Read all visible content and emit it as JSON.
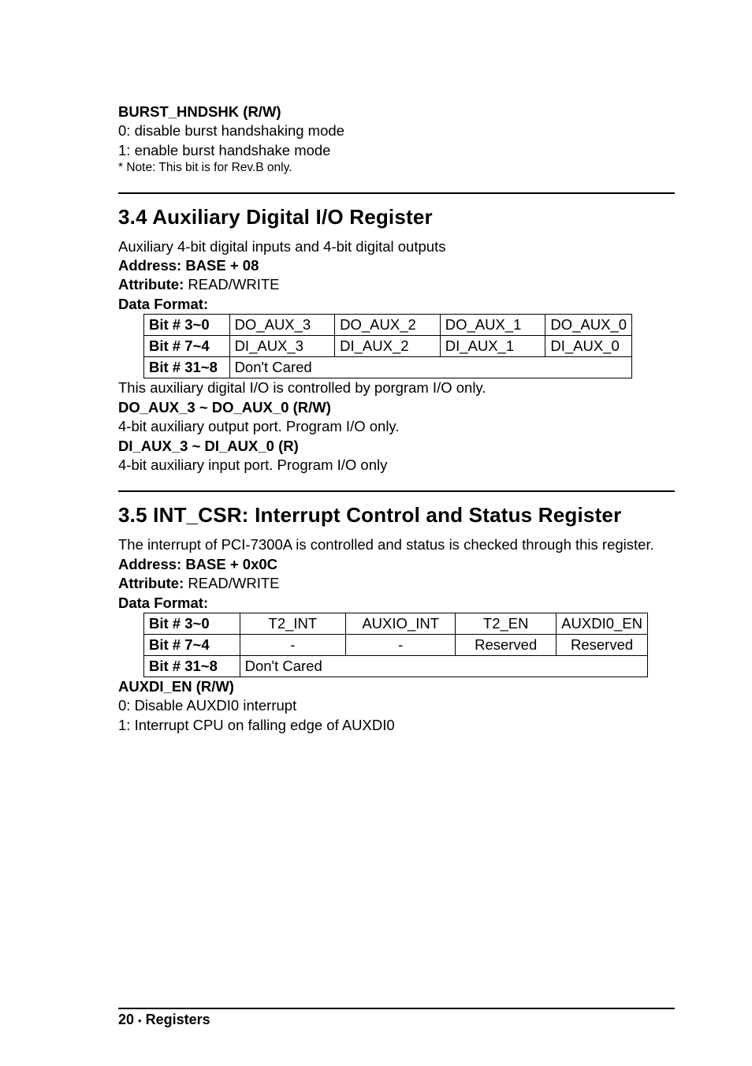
{
  "block1": {
    "title": "BURST_HNDSHK (R/W)",
    "line0": "0: disable burst handshaking mode",
    "line1": "1: enable burst handshake mode",
    "note": "* Note: This bit is for Rev.B only."
  },
  "sec34": {
    "heading": "3.4  Auxiliary Digital I/O Register",
    "desc": "Auxiliary 4-bit digital inputs and 4-bit digital outputs",
    "addr_label": "Address: BASE + 08",
    "attr_label": "Attribute:",
    "attr_value": " READ/WRITE",
    "df_label": "Data Format:",
    "table": {
      "r0": {
        "h": "Bit # 3~0",
        "c0": "DO_AUX_3",
        "c1": "DO_AUX_2",
        "c2": "DO_AUX_1",
        "c3": "DO_AUX_0"
      },
      "r1": {
        "h": "Bit # 7~4",
        "c0": "DI_AUX_3",
        "c1": "DI_AUX_2",
        "c2": "DI_AUX_1",
        "c3": "DI_AUX_0"
      },
      "r2": {
        "h": "Bit # 31~8",
        "c0": "Don't Cared"
      }
    },
    "after_table": "This auxiliary digital I/O is controlled by porgram I/O only.",
    "doaux_title": "DO_AUX_3 ~ DO_AUX_0 (R/W)",
    "doaux_desc": "4-bit auxiliary output port. Program I/O only.",
    "diaux_title": "DI_AUX_3 ~ DI_AUX_0 (R)",
    "diaux_desc": "4-bit auxiliary input port. Program I/O only"
  },
  "sec35": {
    "heading": "3.5  INT_CSR: Interrupt Control and Status Register",
    "desc": "The interrupt of PCI-7300A is controlled and status is checked through this register.",
    "addr_label": "Address: BASE + 0x0C",
    "attr_label": "Attribute:",
    "attr_value": " READ/WRITE",
    "df_label": "Data Format:",
    "table": {
      "r0": {
        "h": "Bit # 3~0",
        "c0": "T2_INT",
        "c1": "AUXIO_INT",
        "c2": "T2_EN",
        "c3": "AUXDI0_EN"
      },
      "r1": {
        "h": "Bit # 7~4",
        "c0": "-",
        "c1": "-",
        "c2": "Reserved",
        "c3": "Reserved"
      },
      "r2": {
        "h": "Bit # 31~8",
        "c0": "Don't Cared"
      }
    },
    "auxdi_title": "AUXDI_EN (R/W)",
    "auxdi_l0": "0: Disable AUXDI0 interrupt",
    "auxdi_l1": "1: Interrupt CPU on falling edge of AUXDI0"
  },
  "footer": {
    "page": "20",
    "sep": "•",
    "label": "Registers"
  }
}
